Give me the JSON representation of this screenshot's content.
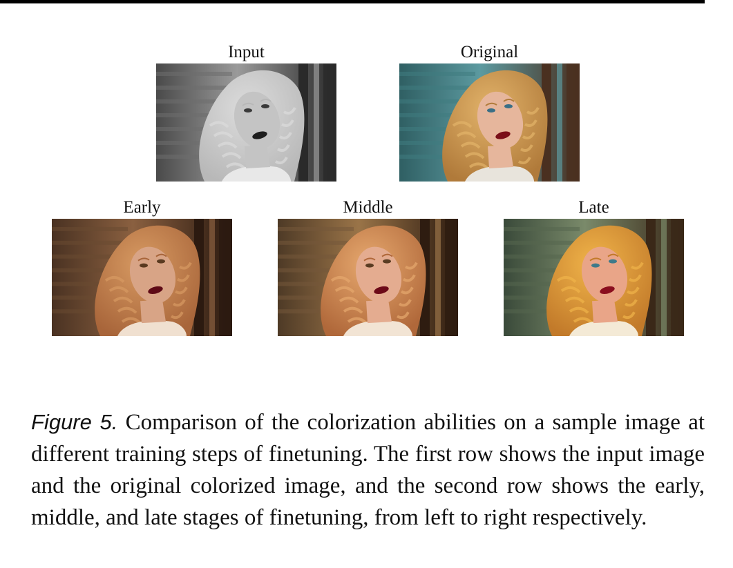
{
  "figure": {
    "panels": [
      {
        "key": "input",
        "label": "Input",
        "tone": "grayscale"
      },
      {
        "key": "original",
        "label": "Original",
        "tone": "teal-warm"
      },
      {
        "key": "early",
        "label": "Early",
        "tone": "sepia"
      },
      {
        "key": "middle",
        "label": "Middle",
        "tone": "warm-sepia"
      },
      {
        "key": "late",
        "label": "Late",
        "tone": "green-gold"
      }
    ],
    "caption": {
      "label": "Figure 5.",
      "text": "Comparison of the colorization abilities on a sample image at different training steps of finetuning. The first row shows the input image and the original colorized image, and the second row shows the early, middle, and late stages of finetuning, from left to right respectively."
    }
  },
  "colors": {
    "grayscale": {
      "bg": "#4a4a4a",
      "bg2": "#9a9a9a",
      "wall": "#6e6e6e",
      "hair": "#b8b8b8",
      "hair2": "#dcdcdc",
      "skin": "#c4c4c4",
      "lips": "#1e1e1e",
      "door": "#2a2a2a",
      "shirt": "#e8e8e8",
      "eye": "#3a3a3a"
    },
    "teal-warm": {
      "bg": "#2f5f63",
      "bg2": "#5c9aa0",
      "wall": "#3f7b80",
      "hair": "#b07a3a",
      "hair2": "#e2b36a",
      "skin": "#e6b69c",
      "lips": "#7a0f18",
      "door": "#4a3020",
      "shirt": "#e8e4dc",
      "eye": "#3a6f86"
    },
    "sepia": {
      "bg": "#4a3222",
      "bg2": "#8a6040",
      "wall": "#6a4a32",
      "hair": "#a8653a",
      "hair2": "#d79a62",
      "skin": "#d8a486",
      "lips": "#5e0a16",
      "door": "#2c1a10",
      "shirt": "#f0e0d0",
      "eye": "#5a3a20"
    },
    "warm-sepia": {
      "bg": "#4e3a26",
      "bg2": "#9a7448",
      "wall": "#75573a",
      "hair": "#b0683a",
      "hair2": "#e6a86e",
      "skin": "#e4ac90",
      "lips": "#6c0a18",
      "door": "#2e1c10",
      "shirt": "#f2e4d4",
      "eye": "#5a3c22"
    },
    "green-gold": {
      "bg": "#3a4a3a",
      "bg2": "#7a8a6a",
      "wall": "#55664e",
      "hair": "#c27a2a",
      "hair2": "#f0b44a",
      "skin": "#e9a588",
      "lips": "#8a0e1e",
      "door": "#3a2818",
      "shirt": "#f4ead6",
      "eye": "#3e7a8a"
    }
  }
}
